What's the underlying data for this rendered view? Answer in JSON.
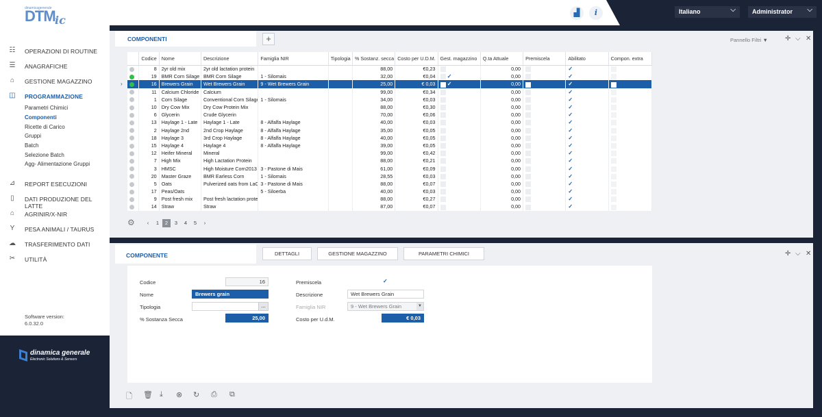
{
  "header": {
    "logo_small": "dinamicagenerale",
    "logo_main": "DTM",
    "logo_suffix": "ic",
    "language": "Italiano",
    "user": "Administrator"
  },
  "sidebar": {
    "items": [
      {
        "label": "OPERAZIONI DI ROUTINE",
        "icon": "routine-icon"
      },
      {
        "label": "ANAGRAFICHE",
        "icon": "list-icon"
      },
      {
        "label": "GESTIONE MAGAZZINO",
        "icon": "warehouse-icon"
      },
      {
        "label": "PROGRAMMAZIONE",
        "icon": "programming-icon"
      },
      {
        "label": "REPORT ESECUZIONI",
        "icon": "report-icon"
      },
      {
        "label": "DATI PRODUZIONE DEL LATTE",
        "icon": "milk-icon"
      },
      {
        "label": "AGRINIR/X-NIR",
        "icon": "nir-icon"
      },
      {
        "label": "PESA ANIMALI / TAURUS",
        "icon": "scale-icon"
      },
      {
        "label": "TRASFERIMENTO DATI",
        "icon": "cloud-transfer-icon"
      },
      {
        "label": "UTILITÀ",
        "icon": "tools-icon"
      }
    ],
    "subitems": [
      "Parametri Chimici",
      "Componenti",
      "Ricette di Carico",
      "Gruppi",
      "Batch",
      "Selezione Batch",
      "Agg- Alimentazione Gruppi"
    ],
    "version_label": "Software version:",
    "version": "6.0.32.0",
    "brand_name": "dinamica generale",
    "brand_tag": "Electronic Solutions & Sensors"
  },
  "top_panel": {
    "tab": "COMPONENTI",
    "add": "+",
    "filters": "Pannello Filtri",
    "columns": [
      "",
      "Codice",
      "Nome",
      "Descrizione",
      "Famiglia NIR",
      "Tipologia",
      "% Sostanz. secca",
      "Costo per U.D.M.",
      "Gest. magazzino",
      "Q.ta Attuale",
      "Premiscela",
      "Abilitato",
      "Compon. extra"
    ],
    "rows": [
      {
        "status": "grey",
        "code": "8",
        "name": "2yr old mix",
        "desc": "2yr old lactation protein",
        "family": "",
        "type": "",
        "dry": "88,00",
        "cost": "€0,23",
        "mag": false,
        "qty": "0,00",
        "pre": false,
        "en": true,
        "ext": false
      },
      {
        "status": "green",
        "code": "19",
        "name": "BMR Corn Silage",
        "desc": "BMR Corn Silage",
        "family": "1 - Silomais",
        "type": "",
        "dry": "32,00",
        "cost": "€0,04",
        "mag": true,
        "qty": "0,00",
        "pre": false,
        "en": true,
        "ext": false
      },
      {
        "status": "green",
        "code": "16",
        "name": "Brewers Grain",
        "desc": "Wet Brewers Grain",
        "family": "9 - Wet Brewers Grain",
        "type": "",
        "dry": "25,00",
        "cost": "€ 0,03",
        "mag": true,
        "qty": "0,00",
        "pre": false,
        "en": true,
        "ext": false,
        "selected": true
      },
      {
        "status": "grey",
        "code": "11",
        "name": "Calcium Chloride",
        "desc": "Calcium",
        "family": "",
        "type": "",
        "dry": "99,00",
        "cost": "€0,34",
        "mag": false,
        "qty": "0,00",
        "pre": false,
        "en": true,
        "ext": false
      },
      {
        "status": "grey",
        "code": "1",
        "name": "Corn Silage",
        "desc": "Conventional Corn Silage",
        "family": "1 - Silomais",
        "type": "",
        "dry": "34,00",
        "cost": "€0,03",
        "mag": false,
        "qty": "0,00",
        "pre": false,
        "en": true,
        "ext": false
      },
      {
        "status": "grey",
        "code": "10",
        "name": "Dry Cow Mix",
        "desc": "Dry Cow Protein Mix",
        "family": "",
        "type": "",
        "dry": "88,00",
        "cost": "€0,30",
        "mag": false,
        "qty": "0,00",
        "pre": false,
        "en": true,
        "ext": false
      },
      {
        "status": "grey",
        "code": "6",
        "name": "Glycerin",
        "desc": "Crude Glycerin",
        "family": "",
        "type": "",
        "dry": "70,00",
        "cost": "€0,06",
        "mag": false,
        "qty": "0,00",
        "pre": false,
        "en": true,
        "ext": false
      },
      {
        "status": "grey",
        "code": "13",
        "name": "Haylage 1 - Late",
        "desc": "Haylage 1 - Late",
        "family": "8 - Alfalfa Haylage",
        "type": "",
        "dry": "40,00",
        "cost": "€0,03",
        "mag": false,
        "qty": "0,00",
        "pre": false,
        "en": true,
        "ext": false
      },
      {
        "status": "grey",
        "code": "2",
        "name": "Haylage 2nd",
        "desc": "2nd Crop Haylage",
        "family": "8 - Alfalfa Haylage",
        "type": "",
        "dry": "35,00",
        "cost": "€0,05",
        "mag": false,
        "qty": "0,00",
        "pre": false,
        "en": true,
        "ext": false
      },
      {
        "status": "grey",
        "code": "18",
        "name": "Haylage 3",
        "desc": "3rd Crop Haylage",
        "family": "8 - Alfalfa Haylage",
        "type": "",
        "dry": "40,00",
        "cost": "€0,05",
        "mag": false,
        "qty": "0,00",
        "pre": false,
        "en": true,
        "ext": false
      },
      {
        "status": "grey",
        "code": "15",
        "name": "Haylage 4",
        "desc": "Haylage 4",
        "family": "8 - Alfalfa Haylage",
        "type": "",
        "dry": "39,00",
        "cost": "€0,05",
        "mag": false,
        "qty": "0,00",
        "pre": false,
        "en": true,
        "ext": false
      },
      {
        "status": "grey",
        "code": "12",
        "name": "Heifer Mineral",
        "desc": "Mineral",
        "family": "",
        "type": "",
        "dry": "99,00",
        "cost": "€0,42",
        "mag": false,
        "qty": "0,00",
        "pre": false,
        "en": true,
        "ext": false
      },
      {
        "status": "grey",
        "code": "7",
        "name": "High Mix",
        "desc": "High Lactation Protein",
        "family": "",
        "type": "",
        "dry": "88,00",
        "cost": "€0,21",
        "mag": false,
        "qty": "0,00",
        "pre": false,
        "en": true,
        "ext": false
      },
      {
        "status": "grey",
        "code": "3",
        "name": "HMSC",
        "desc": "High Moisture Corn2013",
        "family": "3 - Pastone di Mais",
        "type": "",
        "dry": "61,00",
        "cost": "€0,09",
        "mag": false,
        "qty": "0,00",
        "pre": false,
        "en": true,
        "ext": false
      },
      {
        "status": "grey",
        "code": "20",
        "name": "Master Graze",
        "desc": "BMR Earless Corn",
        "family": "1 - Silomais",
        "type": "",
        "dry": "28,55",
        "cost": "€0,03",
        "mag": false,
        "qty": "0,00",
        "pre": false,
        "en": true,
        "ext": false
      },
      {
        "status": "grey",
        "code": "5",
        "name": "Oats",
        "desc": "Pulverized oats from LaCro",
        "family": "3 - Pastone di Mais",
        "type": "",
        "dry": "88,00",
        "cost": "€0,07",
        "mag": false,
        "qty": "0,00",
        "pre": false,
        "en": true,
        "ext": false
      },
      {
        "status": "grey",
        "code": "17",
        "name": "Peas/Oats",
        "desc": "",
        "family": "5 - Siloerba",
        "type": "",
        "dry": "40,00",
        "cost": "€0,03",
        "mag": false,
        "qty": "0,00",
        "pre": false,
        "en": true,
        "ext": false
      },
      {
        "status": "grey",
        "code": "9",
        "name": "Post fresh mix",
        "desc": "Post fresh lactation protein",
        "family": "",
        "type": "",
        "dry": "88,00",
        "cost": "€0,27",
        "mag": false,
        "qty": "0,00",
        "pre": false,
        "en": true,
        "ext": false
      },
      {
        "status": "grey",
        "code": "14",
        "name": "Straw",
        "desc": "Straw",
        "family": "",
        "type": "",
        "dry": "87,00",
        "cost": "€0,07",
        "mag": false,
        "qty": "0,00",
        "pre": false,
        "en": true,
        "ext": false
      }
    ],
    "pager": {
      "prev": "‹",
      "pages": [
        "1",
        "2",
        "3",
        "4",
        "5"
      ],
      "current": "2",
      "next": "›"
    }
  },
  "bottom_panel": {
    "tab": "COMPONENTE",
    "subtabs": [
      "DETTAGLI",
      "GESTIONE MAGAZZINO",
      "PARAMETRI CHIMICI"
    ],
    "form": {
      "code_label": "Codice",
      "code": "16",
      "name_label": "Nome",
      "name": "Brewers grain",
      "type_label": "Tipologia",
      "type": "",
      "type_btn": "...",
      "dry_label": "% Sostanza Secca",
      "dry": "25,00",
      "premix_label": "Premiscela",
      "desc_label": "Descrizione",
      "desc": "Wet Brewers Grain",
      "family_label": "Famiglia NIR",
      "family": "9 - Wet Brewers Grain",
      "cost_label": "Costo per U.d.M.",
      "cost": "€ 0,03"
    }
  }
}
